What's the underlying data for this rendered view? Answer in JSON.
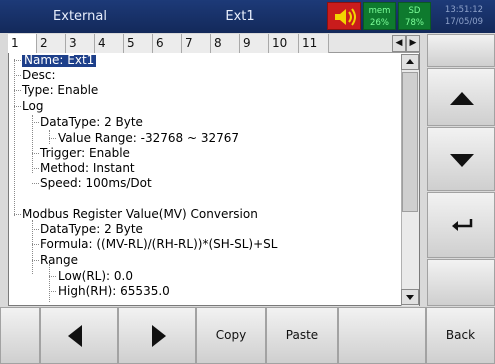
{
  "titlebar": {
    "left": "External",
    "center": "Ext1",
    "mem": {
      "label": "mem",
      "value": "26%"
    },
    "sd": {
      "label": "SD",
      "value": "78%"
    },
    "clock": {
      "line1": "13:51:12",
      "line2": "17/05/09"
    }
  },
  "tabs": [
    "1",
    "2",
    "3",
    "4",
    "5",
    "6",
    "7",
    "8",
    "9",
    "10",
    "11"
  ],
  "tree": [
    {
      "text": "Name: Ext1",
      "selected": true
    },
    {
      "text": "Desc:"
    },
    {
      "text": "Type: Enable"
    },
    {
      "text": "Log"
    },
    {
      "text": "DataType: 2 Byte"
    },
    {
      "text": "Value Range: -32768 ~ 32767"
    },
    {
      "text": "Trigger: Enable"
    },
    {
      "text": "Method: Instant"
    },
    {
      "text": "Speed: 100ms/Dot"
    },
    {
      "text": "Modbus Register Value(MV) Conversion"
    },
    {
      "text": "DataType: 2 Byte"
    },
    {
      "text": "Formula: ((MV-RL)/(RH-RL))*(SH-SL)+SL"
    },
    {
      "text": "Range"
    },
    {
      "text": "Low(RL): 0.0"
    },
    {
      "text": "High(RH): 65535.0"
    }
  ],
  "bottom": {
    "copy": "Copy",
    "paste": "Paste",
    "back": "Back"
  },
  "icons": [
    "speaker-mute-icon",
    "left-arrow-icon",
    "right-arrow-icon",
    "up-arrow-icon",
    "down-arrow-icon",
    "enter-icon",
    "scroll-up-icon",
    "scroll-down-icon",
    "tab-scroll-left-icon",
    "tab-scroll-right-icon"
  ]
}
